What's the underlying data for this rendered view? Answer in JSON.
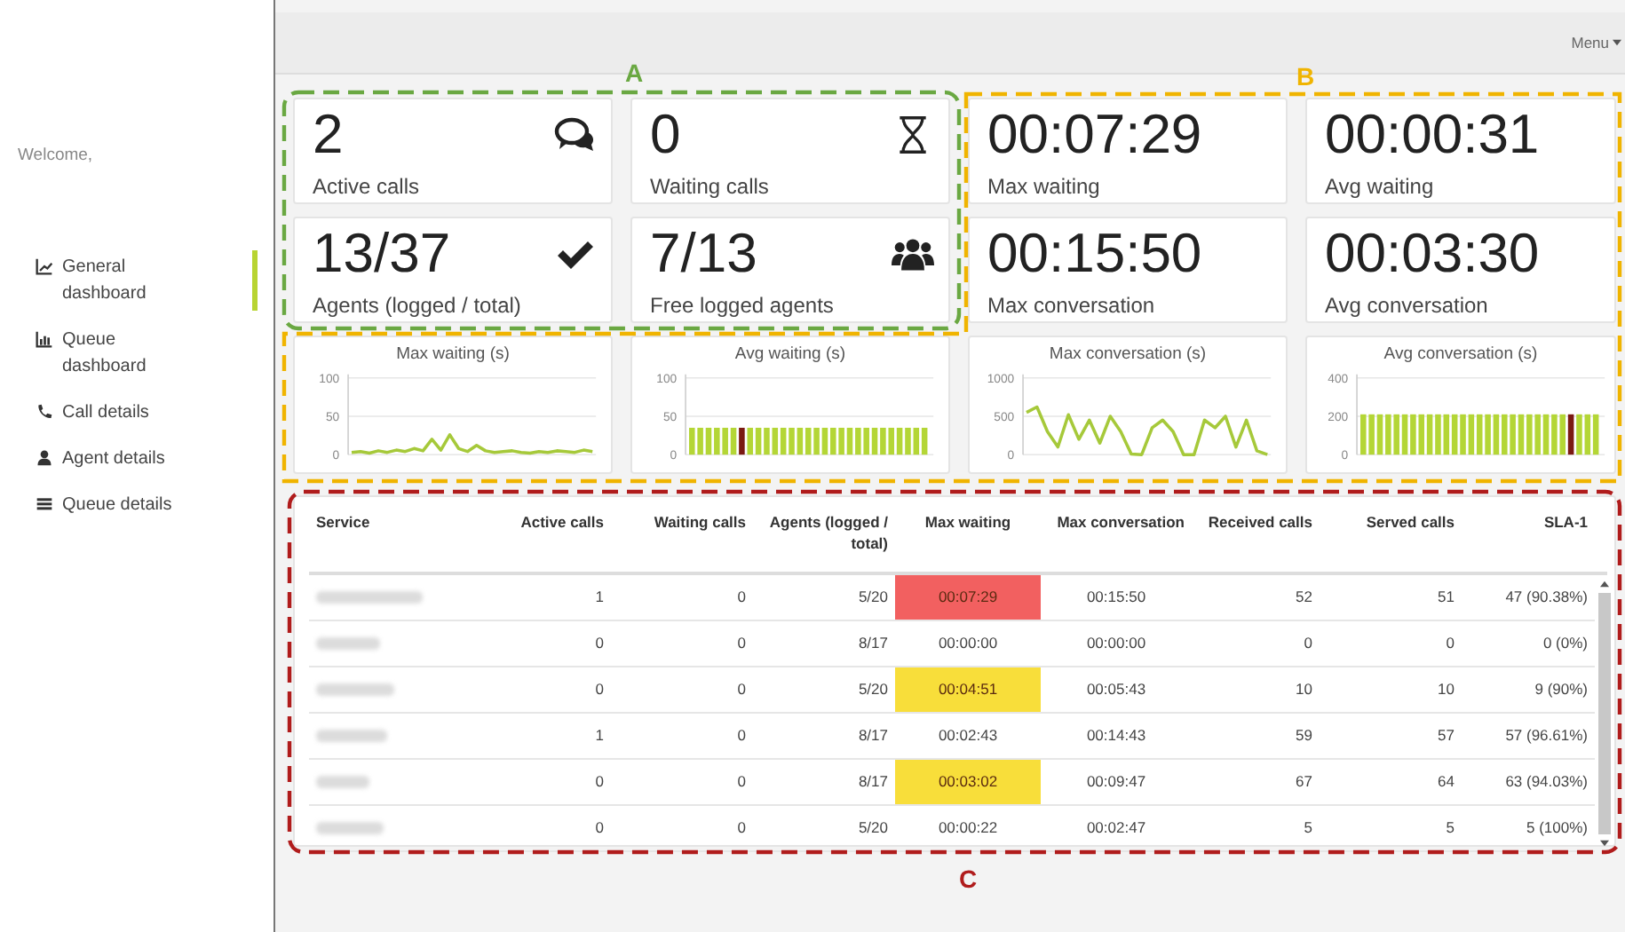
{
  "sidebar": {
    "welcome": "Welcome,",
    "items": [
      {
        "label": "General dashboard",
        "kind": "line-chart",
        "selected": true
      },
      {
        "label": "Queue dashboard",
        "kind": "bar-chart",
        "selected": false
      },
      {
        "label": "Call details",
        "kind": "phone",
        "selected": false
      },
      {
        "label": "Agent details",
        "kind": "user",
        "selected": false
      },
      {
        "label": "Queue details",
        "kind": "list",
        "selected": false
      }
    ]
  },
  "header": {
    "menu": "Menu"
  },
  "annotations": [
    {
      "label": "A",
      "color": "#6aa842"
    },
    {
      "label": "B",
      "color": "#f0b400"
    },
    {
      "label": "C",
      "color": "#b01c1c"
    }
  ],
  "stat_cards": [
    {
      "value": "2",
      "label": "Active calls",
      "kind": "chat"
    },
    {
      "value": "0",
      "label": "Waiting calls",
      "kind": "hourglass"
    },
    {
      "value": "00:07:29",
      "label": "Max waiting",
      "kind": "plain"
    },
    {
      "value": "00:00:31",
      "label": "Avg waiting",
      "kind": "plain"
    },
    {
      "value": "13/37",
      "label": "Agents (logged / total)",
      "kind": "check"
    },
    {
      "value": "7/13",
      "label": "Free logged agents",
      "kind": "users"
    },
    {
      "value": "00:15:50",
      "label": "Max conversation",
      "kind": "plain"
    },
    {
      "value": "00:03:30",
      "label": "Avg conversation",
      "kind": "plain"
    }
  ],
  "charts": [
    {
      "chart_data": {
        "type": "line",
        "title": "Max waiting (s)",
        "ylim": [
          0,
          100
        ],
        "yticks": [
          0,
          50,
          100
        ],
        "series": [
          {
            "color": "#a6c93a",
            "values": [
              3,
              4,
              2,
              5,
              3,
              6,
              4,
              8,
              5,
              20,
              6,
              26,
              8,
              4,
              12,
              5,
              3,
              4,
              5,
              3,
              2,
              4,
              3,
              5,
              4,
              3,
              6,
              4
            ]
          }
        ]
      }
    },
    {
      "chart_data": {
        "type": "bar",
        "title": "Avg waiting (s)",
        "ylim": [
          0,
          100
        ],
        "yticks": [
          0,
          50,
          100
        ],
        "series": [
          {
            "color": "#b4d636",
            "values": [
              35,
              35,
              35,
              35,
              35,
              35,
              null,
              35,
              35,
              35,
              35,
              35,
              35,
              35,
              35,
              35,
              35,
              35,
              35,
              35,
              35,
              35,
              35,
              35,
              35,
              35,
              35,
              35,
              35
            ]
          },
          {
            "color": "#7a1a12",
            "values": [
              null,
              null,
              null,
              null,
              null,
              null,
              35,
              null,
              null,
              null,
              null,
              null,
              null,
              null,
              null,
              null,
              null,
              null,
              null,
              null,
              null,
              null,
              null,
              null,
              null,
              null,
              null,
              null,
              null
            ]
          }
        ]
      }
    },
    {
      "chart_data": {
        "type": "line",
        "title": "Max conversation (s)",
        "ylim": [
          0,
          1000
        ],
        "yticks": [
          0,
          500,
          1000
        ],
        "series": [
          {
            "color": "#a6c93a",
            "values": [
              550,
              620,
              300,
              100,
              520,
              200,
              450,
              150,
              500,
              300,
              10,
              0,
              350,
              450,
              300,
              0,
              0,
              450,
              350,
              500,
              100,
              450,
              50,
              0
            ]
          }
        ]
      }
    },
    {
      "chart_data": {
        "type": "bar",
        "title": "Avg conversation (s)",
        "ylim": [
          0,
          400
        ],
        "yticks": [
          0,
          200,
          400
        ],
        "series": [
          {
            "color": "#b4d636",
            "values": [
              210,
              210,
              210,
              210,
              210,
              210,
              210,
              210,
              210,
              210,
              210,
              210,
              210,
              210,
              210,
              210,
              210,
              210,
              210,
              210,
              210,
              210,
              210,
              210,
              210,
              null,
              210,
              210,
              210
            ]
          },
          {
            "color": "#7a1a12",
            "values": [
              null,
              null,
              null,
              null,
              null,
              null,
              null,
              null,
              null,
              null,
              null,
              null,
              null,
              null,
              null,
              null,
              null,
              null,
              null,
              null,
              null,
              null,
              null,
              null,
              null,
              210,
              null,
              null,
              null
            ]
          }
        ]
      }
    }
  ],
  "table": {
    "columns": [
      "Service",
      "Active calls",
      "Waiting calls",
      "Agents (logged / total)",
      "Max waiting",
      "Max conversation",
      "Received calls",
      "Served calls",
      "SLA-1"
    ],
    "rows": [
      {
        "color": "#f26060",
        "cells": [
          "",
          "1",
          "0",
          "5/20",
          "00:07:29",
          "00:15:50",
          "52",
          "51",
          "47 (90.38%)"
        ]
      },
      {
        "cells": [
          "",
          "0",
          "0",
          "8/17",
          "00:00:00",
          "00:00:00",
          "0",
          "0",
          "0 (0%)"
        ]
      },
      {
        "color": "#f8de3a",
        "cells": [
          "",
          "0",
          "0",
          "5/20",
          "00:04:51",
          "00:05:43",
          "10",
          "10",
          "9 (90%)"
        ]
      },
      {
        "cells": [
          "",
          "1",
          "0",
          "8/17",
          "00:02:43",
          "00:14:43",
          "59",
          "57",
          "57 (96.61%)"
        ]
      },
      {
        "color": "#f8de3a",
        "cells": [
          "",
          "0",
          "0",
          "8/17",
          "00:03:02",
          "00:09:47",
          "67",
          "64",
          "63 (94.03%)"
        ]
      },
      {
        "cells": [
          "",
          "0",
          "0",
          "5/20",
          "00:00:22",
          "00:02:47",
          "5",
          "5",
          "5 (100%)"
        ]
      }
    ]
  }
}
